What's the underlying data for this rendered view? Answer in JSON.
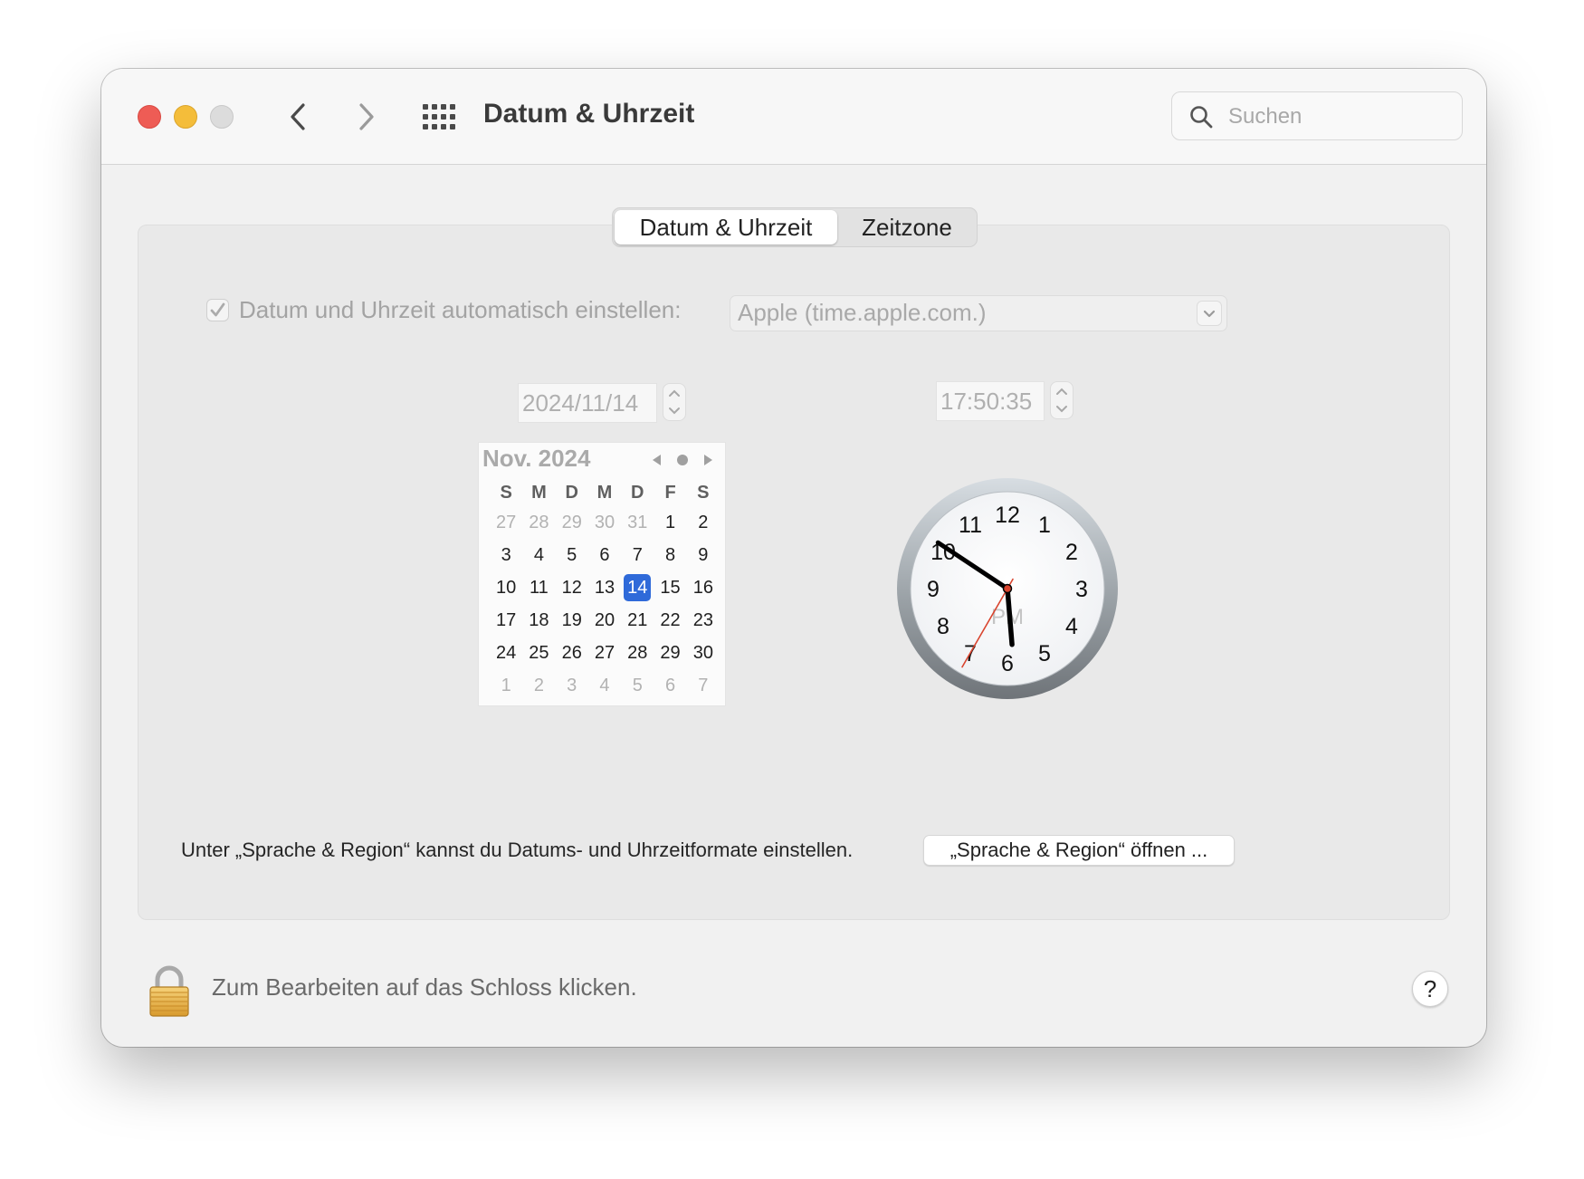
{
  "window": {
    "title": "Datum & Uhrzeit",
    "search_placeholder": "Suchen"
  },
  "tabs": [
    {
      "label": "Datum & Uhrzeit",
      "active": true
    },
    {
      "label": "Zeitzone",
      "active": false
    }
  ],
  "auto": {
    "label": "Datum und Uhrzeit automatisch einstellen:",
    "checked": true,
    "server": "Apple (time.apple.com.)"
  },
  "date_value": "2024/11/14",
  "time_value": "17:50:35",
  "calendar": {
    "title": "Nov. 2024",
    "weekdays": [
      "S",
      "M",
      "D",
      "M",
      "D",
      "F",
      "S"
    ],
    "weeks": [
      [
        {
          "d": "27",
          "m": true
        },
        {
          "d": "28",
          "m": true
        },
        {
          "d": "29",
          "m": true
        },
        {
          "d": "30",
          "m": true
        },
        {
          "d": "31",
          "m": true
        },
        {
          "d": "1"
        },
        {
          "d": "2"
        }
      ],
      [
        {
          "d": "3"
        },
        {
          "d": "4"
        },
        {
          "d": "5"
        },
        {
          "d": "6"
        },
        {
          "d": "7"
        },
        {
          "d": "8"
        },
        {
          "d": "9"
        }
      ],
      [
        {
          "d": "10"
        },
        {
          "d": "11"
        },
        {
          "d": "12"
        },
        {
          "d": "13"
        },
        {
          "d": "14",
          "sel": true
        },
        {
          "d": "15"
        },
        {
          "d": "16"
        }
      ],
      [
        {
          "d": "17"
        },
        {
          "d": "18"
        },
        {
          "d": "19"
        },
        {
          "d": "20"
        },
        {
          "d": "21"
        },
        {
          "d": "22"
        },
        {
          "d": "23"
        }
      ],
      [
        {
          "d": "24"
        },
        {
          "d": "25"
        },
        {
          "d": "26"
        },
        {
          "d": "27"
        },
        {
          "d": "28"
        },
        {
          "d": "29"
        },
        {
          "d": "30"
        }
      ],
      [
        {
          "d": "1",
          "m": true
        },
        {
          "d": "2",
          "m": true
        },
        {
          "d": "3",
          "m": true
        },
        {
          "d": "4",
          "m": true
        },
        {
          "d": "5",
          "m": true
        },
        {
          "d": "6",
          "m": true
        },
        {
          "d": "7",
          "m": true
        }
      ]
    ]
  },
  "clock": {
    "numbers": [
      "12",
      "1",
      "2",
      "3",
      "4",
      "5",
      "6",
      "7",
      "8",
      "9",
      "10",
      "11"
    ],
    "ampm": "PM",
    "hours": 17,
    "minutes": 50,
    "seconds": 35
  },
  "region_info": "Unter „Sprache & Region“ kannst du Datums- und Uhrzeitformate einstellen.",
  "region_button": "„Sprache & Region“ öffnen ...",
  "lock_text": "Zum Bearbeiten auf das Schloss klicken.",
  "help_label": "?",
  "colors": {
    "selection": "#2f6ad9",
    "close": "#ee5c55",
    "minimize": "#f4bd3a",
    "zoom": "#dcdcdc",
    "second_hand": "#d9442e"
  },
  "icons": [
    "back-chevron-icon",
    "forward-chevron-icon",
    "grid-icon",
    "search-icon",
    "checkmark-icon",
    "chevron-down-icon",
    "lock-icon"
  ]
}
